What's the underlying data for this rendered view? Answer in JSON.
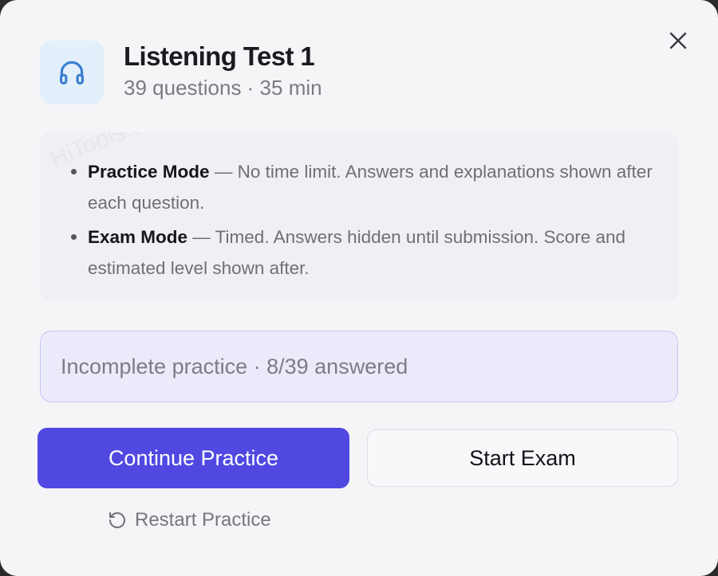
{
  "header": {
    "title": "Listening Test 1",
    "subtitle": "39 questions · 35 min",
    "icon": "headphones-icon",
    "close_icon": "close-icon"
  },
  "info": {
    "watermark": "HiTools.com",
    "items": [
      {
        "mode": "Practice Mode",
        "description": " — No time limit. Answers and explanations shown after each question."
      },
      {
        "mode": "Exam Mode",
        "description": " — Timed. Answers hidden until submission. Score and estimated level shown after."
      }
    ]
  },
  "status": {
    "text": "Incomplete practice · 8/39 answered"
  },
  "actions": {
    "primary_label": "Continue Practice",
    "secondary_label": "Start Exam",
    "restart_label": "Restart Practice",
    "restart_icon": "restart-icon"
  },
  "colors": {
    "accent": "#5048e1",
    "icon_blue": "#3a7fd0",
    "icon_tile": "#e3effb",
    "status_bg": "#ebeafa",
    "status_border": "#c9c5f1",
    "background": "#f5f5f8"
  }
}
